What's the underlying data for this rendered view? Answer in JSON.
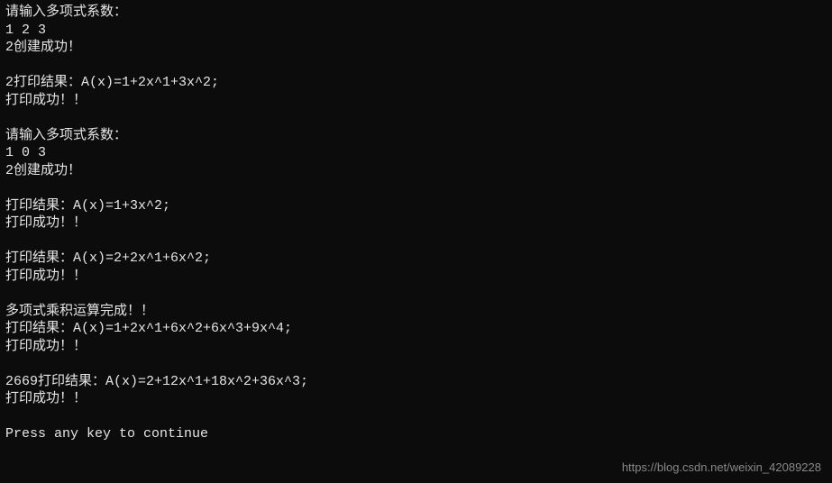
{
  "console": {
    "lines": [
      "请输入多项式系数：",
      "1 2 3",
      "2创建成功！",
      "",
      "2打印结果：A(x)=1+2x^1+3x^2;",
      "打印成功！！",
      "",
      "请输入多项式系数：",
      "1 0 3",
      "2创建成功！",
      "",
      "打印结果：A(x)=1+3x^2;",
      "打印成功！！",
      "",
      "打印结果：A(x)=2+2x^1+6x^2;",
      "打印成功！！",
      "",
      "多项式乘积运算完成！！",
      "打印结果：A(x)=1+2x^1+6x^2+6x^3+9x^4;",
      "打印成功！！",
      "",
      "2669打印结果：A(x)=2+12x^1+18x^2+36x^3;",
      "打印成功！！",
      "",
      "Press any key to continue"
    ]
  },
  "watermark": "https://blog.csdn.net/weixin_42089228"
}
